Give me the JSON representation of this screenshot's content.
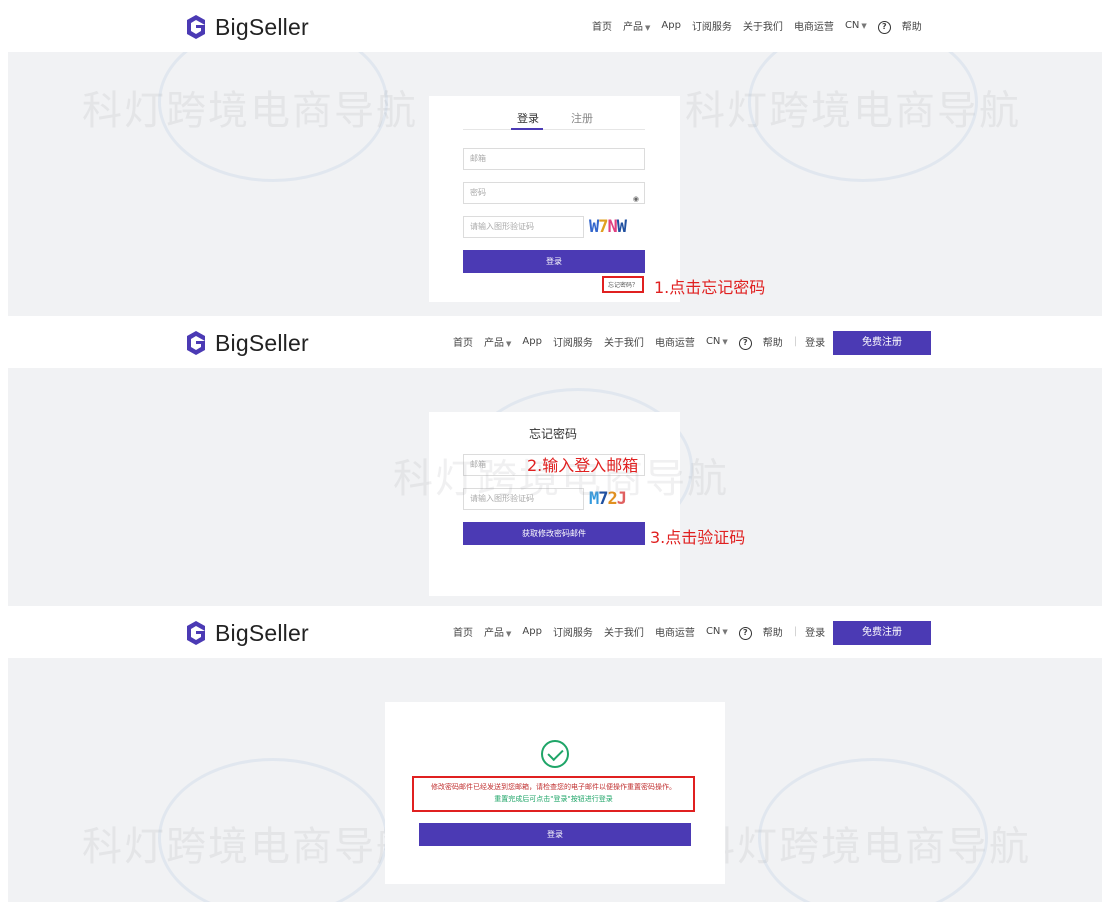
{
  "brand": {
    "name": "BigSeller",
    "accent": "#4b3ab4",
    "annotation_color": "#e02020",
    "success_color": "#1fa568"
  },
  "nav": {
    "home": "首页",
    "product": "产品",
    "app": "App",
    "subscription": "订阅服务",
    "about": "关于我们",
    "ecommerce": "电商运营",
    "lang": "CN",
    "help": "帮助",
    "login": "登录",
    "register": "免费注册"
  },
  "watermark": "科灯跨境电商导航",
  "step1": {
    "tab_login": "登录",
    "tab_register": "注册",
    "email_placeholder": "邮箱",
    "password_placeholder": "密码",
    "captcha_placeholder": "请输入图形验证码",
    "captcha_code": "W7NW",
    "login_button": "登录",
    "forgot_link": "忘记密码？",
    "annotation": "1.点击忘记密码"
  },
  "step2": {
    "title": "忘记密码",
    "email_placeholder": "邮箱",
    "captcha_placeholder": "请输入图形验证码",
    "captcha_code": "M72J",
    "submit_button": "获取修改密码邮件",
    "annotation_email": "2.输入登入邮箱",
    "annotation_captcha": "3.点击验证码"
  },
  "step3": {
    "message_line1": "修改密码邮件已经发送到您邮箱，请检查您的电子邮件以便操作重置密码操作。",
    "message_line2": "重置完成后可点击\"登录\"按钮进行登录",
    "login_button": "登录"
  }
}
